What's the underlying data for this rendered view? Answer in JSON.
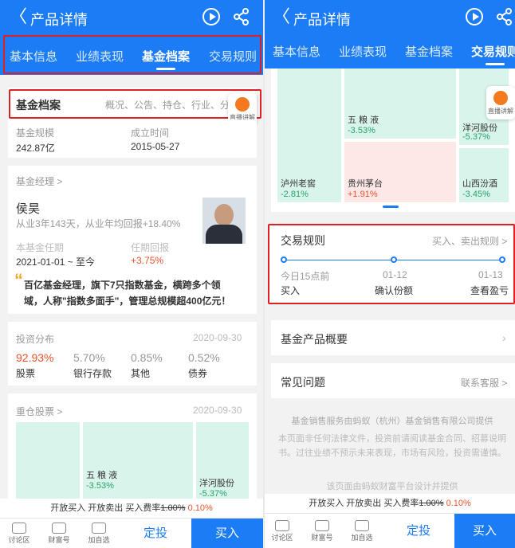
{
  "header": {
    "title": "产品详情",
    "back_glyph": "〈"
  },
  "tabs": [
    "基本信息",
    "业绩表现",
    "基金档案",
    "交易规则"
  ],
  "panel1": {
    "archive_title": "基金档案",
    "archive_sub": "概况、公告、持仓、行业、分",
    "live_label": "直播讲解",
    "scale_label": "基金规模",
    "scale_value": "242.87亿",
    "setup_label": "成立时间",
    "setup_value": "2015-05-27",
    "manager_header": "基金经理 >",
    "manager_name": "侯昊",
    "manager_desc": "从业3年143天，从业年均回报+18.40%",
    "tenure_label": "本基金任期",
    "tenure_value": "2021-01-01 ~ 至今",
    "tenure_return_label": "任期回报",
    "tenure_return_value": "+3.75%",
    "quote": "百亿基金经理，旗下7只指数基金，横跨多个领域，人称\"指数多面手\"，管理总规模超400亿元！",
    "alloc_title": "投资分布",
    "alloc_date": "2020-09-30",
    "alloc": [
      {
        "pct": "92.93%",
        "label": "股票"
      },
      {
        "pct": "5.70%",
        "label": "银行存款"
      },
      {
        "pct": "0.85%",
        "label": "其他"
      },
      {
        "pct": "0.52%",
        "label": "债券"
      }
    ],
    "holdings_title": "重仓股票 >",
    "holdings_date": "2020-09-30",
    "tiles": [
      {
        "name": "五 粮 液",
        "chg": "-3.53%"
      },
      {
        "name": "洋河股份",
        "chg": "-5.37%"
      }
    ]
  },
  "panel2": {
    "tiles": [
      {
        "name": "五 粮 液",
        "chg": "-3.53%"
      },
      {
        "name": "洋河股份",
        "chg": "-5.37%"
      },
      {
        "name": "泸州老窖",
        "chg": "-2.81%"
      },
      {
        "name": "贵州茅台",
        "chg": "+1.91%"
      },
      {
        "name": "山西汾酒",
        "chg": "-3.45%"
      }
    ],
    "live_label": "直播讲解",
    "rules_title": "交易规则",
    "rules_link": "买入、卖出规则 >",
    "timeline": [
      {
        "date": "今日15点前",
        "label": "买入"
      },
      {
        "date": "01-12",
        "label": "确认份额"
      },
      {
        "date": "01-13",
        "label": "查看盈亏"
      }
    ],
    "overview": "基金产品概要",
    "faq": "常见问题",
    "faq_link": "联系客服 >",
    "footer1": "基金销售服务由蚂蚁（杭州）基金销售有限公司提供",
    "footer2": "本页面非任何法律文件，投资前请阅读基金合同、招募说明书。过往业绩不预示未来表现，市场有风险，投资需谨慎。",
    "footer3": "该页面由蚂蚁财富平台设计并提供"
  },
  "fee": {
    "text": "开放买入 开放卖出  买入费率",
    "old": "1.00%",
    "new": "0.10%"
  },
  "bottom": {
    "discuss": "讨论区",
    "wealth": "财富号",
    "watch": "加自选",
    "dingtou": "定投",
    "buy": "买入"
  },
  "colors": {
    "brand": "#1b7cf5",
    "highlight": "#e02020",
    "up": "#e8532b",
    "down": "#24a36b"
  }
}
